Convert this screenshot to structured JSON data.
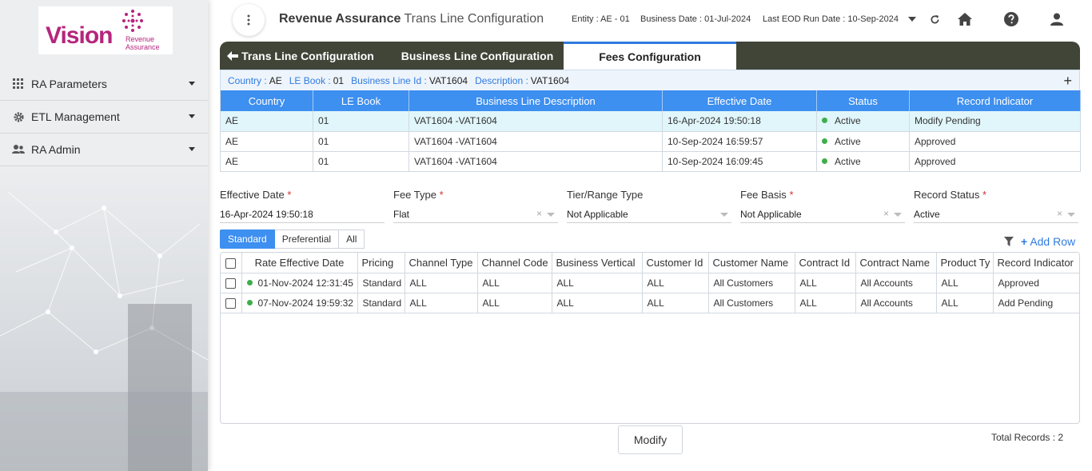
{
  "brand": {
    "logo_text": "Vision",
    "logo_sub_line1": "Revenue",
    "logo_sub_line2": "Assurance",
    "accent": "#b5257d"
  },
  "sidebar": {
    "items": [
      {
        "label": "RA Parameters",
        "icon": "grid-icon"
      },
      {
        "label": "ETL Management",
        "icon": "gear-icon"
      },
      {
        "label": "RA Admin",
        "icon": "users-icon"
      }
    ]
  },
  "header": {
    "title": "Revenue Assurance",
    "subtitle": "- Trans Line Configuration",
    "entity": "Entity : AE - 01",
    "business_date": "Business Date : 01-Jul-2024",
    "last_eod": "Last EOD Run Date : 10-Sep-2024"
  },
  "tabs": {
    "back": "Trans Line Configuration",
    "business_line": "Business Line Configuration",
    "fees": "Fees Configuration"
  },
  "info": {
    "country_k": "Country :",
    "country_v": "AE",
    "lebook_k": "LE Book :",
    "lebook_v": "01",
    "bline_k": "Business Line Id :",
    "bline_v": "VAT1604",
    "desc_k": "Description :",
    "desc_v": "VAT1604"
  },
  "top_table": {
    "headers": [
      "Country",
      "LE Book",
      "Business Line Description",
      "Effective Date",
      "Status",
      "Record Indicator"
    ],
    "rows": [
      [
        "AE",
        "01",
        "VAT1604 -VAT1604",
        "16-Apr-2024 19:50:18",
        "Active",
        "Modify Pending"
      ],
      [
        "AE",
        "01",
        "VAT1604 -VAT1604",
        "10-Sep-2024 16:59:57",
        "Active",
        "Approved"
      ],
      [
        "AE",
        "01",
        "VAT1604 -VAT1604",
        "10-Sep-2024 16:09:45",
        "Active",
        "Approved"
      ]
    ]
  },
  "form": {
    "effective_date": {
      "label": "Effective Date",
      "value": "16-Apr-2024 19:50:18"
    },
    "fee_type": {
      "label": "Fee Type",
      "value": "Flat"
    },
    "tier_range": {
      "label": "Tier/Range Type",
      "value": "Not Applicable"
    },
    "fee_basis": {
      "label": "Fee Basis",
      "value": "Not Applicable"
    },
    "record_status": {
      "label": "Record Status",
      "value": "Active"
    },
    "required_mark": "*",
    "clear": "×"
  },
  "toggle": {
    "standard": "Standard",
    "preferential": "Preferential",
    "all": "All"
  },
  "add_row": "Add Row",
  "detail_table": {
    "headers": [
      "Rate Effective Date",
      "Pricing",
      "Channel Type",
      "Channel Code",
      "Business Vertical",
      "Customer Id",
      "Customer Name",
      "Contract Id",
      "Contract Name",
      "Product Ty",
      "Record Indicator"
    ],
    "rows": [
      [
        "01-Nov-2024 12:31:45",
        "Standard",
        "ALL",
        "ALL",
        "ALL",
        "ALL",
        "All Customers",
        "ALL",
        "All Accounts",
        "ALL",
        "Approved"
      ],
      [
        "07-Nov-2024 19:59:32",
        "Standard",
        "ALL",
        "ALL",
        "ALL",
        "ALL",
        "All Customers",
        "ALL",
        "All Accounts",
        "ALL",
        "Add Pending"
      ]
    ]
  },
  "modify": "Modify",
  "total": "Total Records  :  2"
}
